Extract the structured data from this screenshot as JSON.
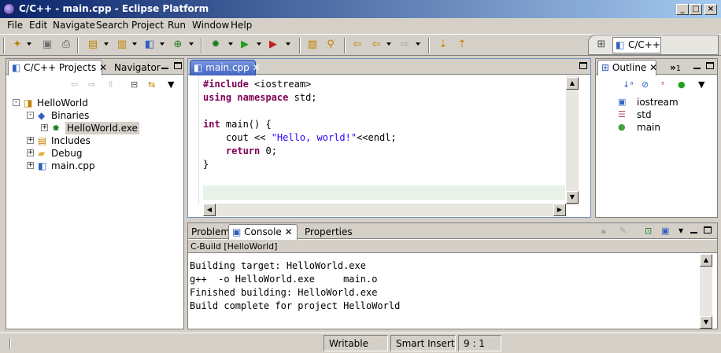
{
  "window": {
    "title": "C/C++ - main.cpp - Eclipse Platform"
  },
  "menu": [
    "File",
    "Edit",
    "Navigate",
    "Search",
    "Project",
    "Run",
    "Window",
    "Help"
  ],
  "perspective": {
    "label": "C/C++"
  },
  "projects_panel": {
    "tabs": [
      "C/C++ Projects",
      "Navigator"
    ],
    "tree": [
      {
        "label": "HelloWorld",
        "depth": 0,
        "expander": "-",
        "icon": "project-icon"
      },
      {
        "label": "Binaries",
        "depth": 1,
        "expander": "-",
        "icon": "binaries-icon"
      },
      {
        "label": "HelloWorld.exe",
        "depth": 2,
        "expander": "+",
        "icon": "executable-icon"
      },
      {
        "label": "Includes",
        "depth": 1,
        "expander": "+",
        "icon": "includes-icon"
      },
      {
        "label": "Debug",
        "depth": 1,
        "expander": "+",
        "icon": "folder-icon"
      },
      {
        "label": "main.cpp",
        "depth": 1,
        "expander": "+",
        "icon": "cpp-file-icon"
      }
    ]
  },
  "editor": {
    "tab": "main.cpp",
    "lines": [
      {
        "parts": [
          {
            "t": "#include",
            "c": "kw"
          },
          {
            "t": " <iostream>",
            "c": ""
          }
        ]
      },
      {
        "parts": [
          {
            "t": "using",
            "c": "kw"
          },
          {
            "t": " ",
            "c": ""
          },
          {
            "t": "namespace",
            "c": "kw"
          },
          {
            "t": " std;",
            "c": ""
          }
        ]
      },
      {
        "parts": []
      },
      {
        "parts": [
          {
            "t": "int",
            "c": "kw"
          },
          {
            "t": " main() {",
            "c": ""
          }
        ]
      },
      {
        "parts": [
          {
            "t": "    cout << ",
            "c": ""
          },
          {
            "t": "\"Hello, world!\"",
            "c": "str"
          },
          {
            "t": "<<endl;",
            "c": ""
          }
        ]
      },
      {
        "parts": [
          {
            "t": "    ",
            "c": ""
          },
          {
            "t": "return",
            "c": "kw"
          },
          {
            "t": " 0;",
            "c": ""
          }
        ]
      },
      {
        "parts": [
          {
            "t": "}",
            "c": ""
          }
        ]
      }
    ]
  },
  "outline": {
    "tab": "Outline",
    "overflow": "1",
    "items": [
      {
        "label": "iostream",
        "icon": "include-icon"
      },
      {
        "label": "std",
        "icon": "namespace-icon"
      },
      {
        "label": "main",
        "icon": "function-icon"
      }
    ]
  },
  "console_panel": {
    "tabs": [
      "Problems",
      "Console",
      "Properties"
    ],
    "header": "C-Build [HelloWorld]",
    "lines": [
      "Building target: HelloWorld.exe",
      "g++  -o HelloWorld.exe     main.o",
      "Finished building: HelloWorld.exe",
      "Build complete for project HelloWorld"
    ]
  },
  "status": {
    "mode": "Writable",
    "insert": "Smart Insert",
    "position": "9 : 1"
  },
  "colors": {
    "title_start": "#0a246a",
    "title_end": "#a6caf0",
    "keyword": "#7f0055",
    "string": "#2a00ff",
    "current_line": "#e8f2e8"
  }
}
